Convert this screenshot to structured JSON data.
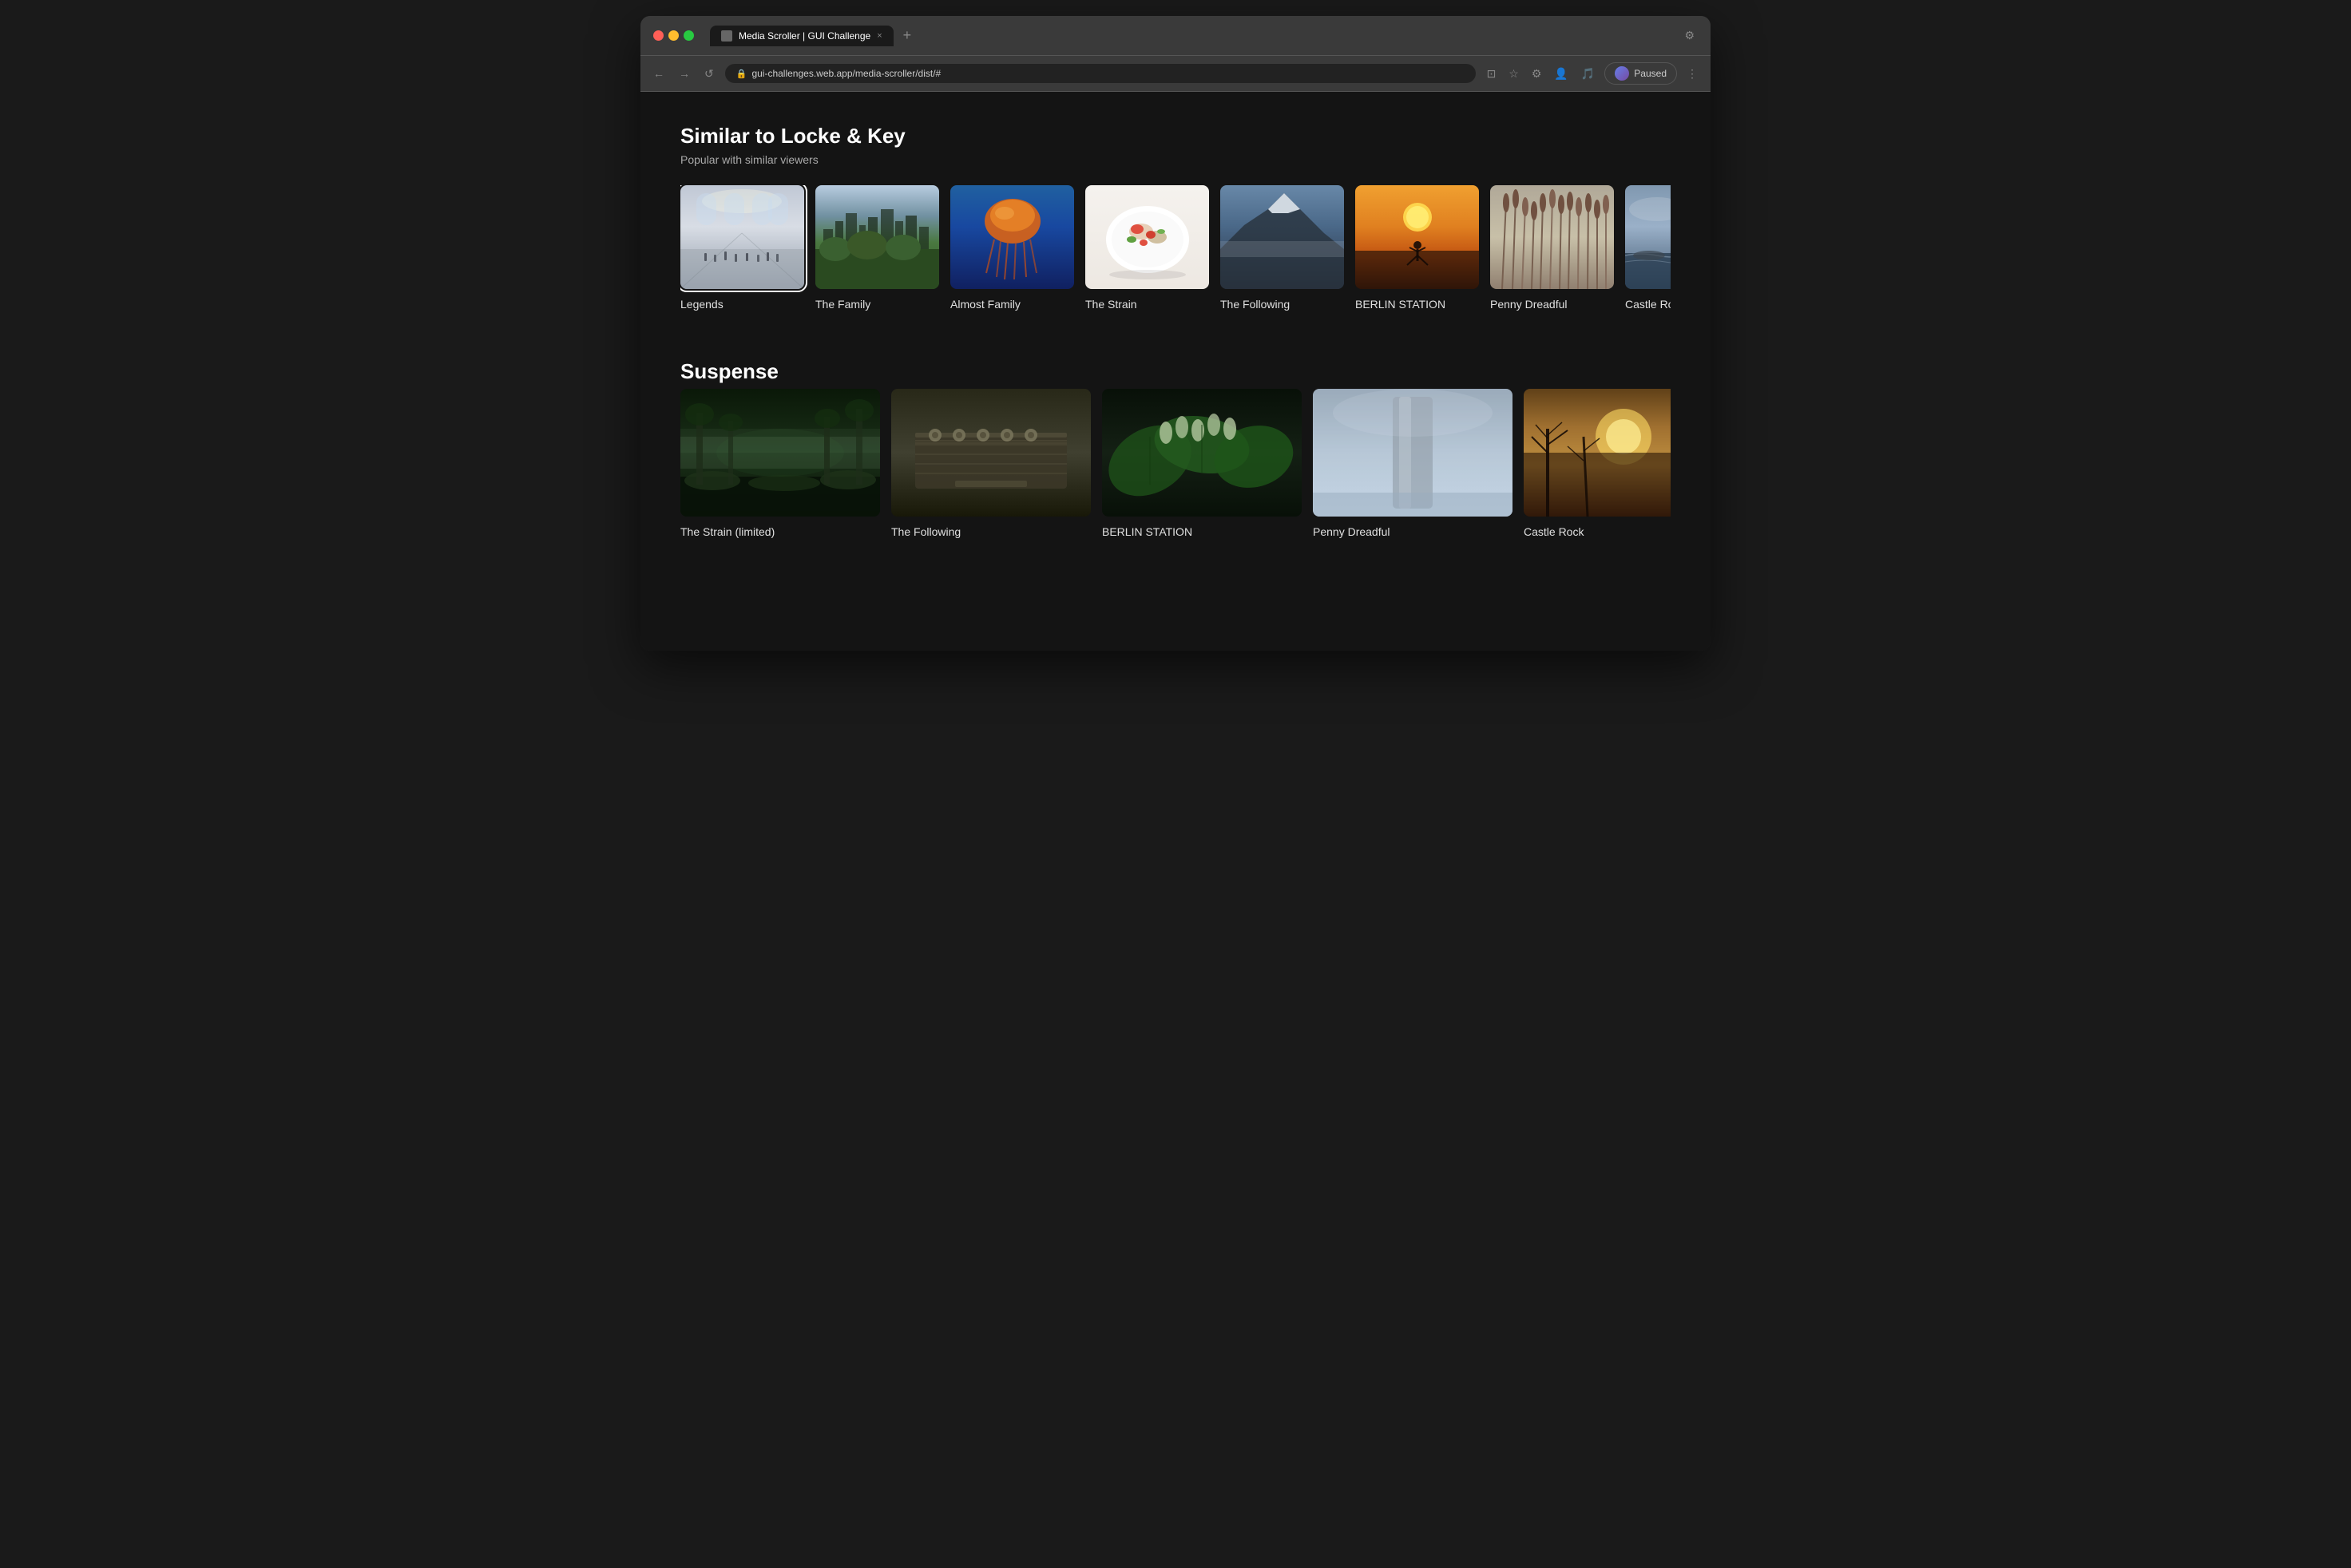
{
  "browser": {
    "traffic_lights": [
      "red",
      "yellow",
      "green"
    ],
    "tab_label": "Media Scroller | GUI Challenge",
    "tab_close": "×",
    "tab_new": "+",
    "nav_back": "←",
    "nav_forward": "→",
    "nav_refresh": "↺",
    "address": "gui-challenges.web.app/media-scroller/dist/#",
    "paused_label": "Paused",
    "menu_icon": "⋮"
  },
  "sections": [
    {
      "id": "similar",
      "title": "Similar to Locke & Key",
      "subtitle": "Popular with similar viewers",
      "items": [
        {
          "id": "legends",
          "label": "Legends",
          "selected": true
        },
        {
          "id": "family",
          "label": "The Family",
          "selected": false
        },
        {
          "id": "almost-family",
          "label": "Almost Family",
          "selected": false
        },
        {
          "id": "strain",
          "label": "The Strain",
          "selected": false
        },
        {
          "id": "following",
          "label": "The Following",
          "selected": false
        },
        {
          "id": "berlin",
          "label": "BERLIN STATION",
          "selected": false
        },
        {
          "id": "penny",
          "label": "Penny Dreadful",
          "selected": false
        },
        {
          "id": "castle-rock",
          "label": "Castle Rock",
          "selected": false
        }
      ]
    },
    {
      "id": "suspense",
      "title": "Suspense",
      "subtitle": "",
      "items": [
        {
          "id": "strain-s",
          "label": "The Strain (limited)",
          "selected": false
        },
        {
          "id": "following-s",
          "label": "The Following",
          "selected": false
        },
        {
          "id": "berlin-s",
          "label": "BERLIN STATION",
          "selected": false
        },
        {
          "id": "penny-s",
          "label": "Penny Dreadful",
          "selected": false
        },
        {
          "id": "castle-s",
          "label": "Castle Rock",
          "selected": false
        }
      ]
    }
  ]
}
